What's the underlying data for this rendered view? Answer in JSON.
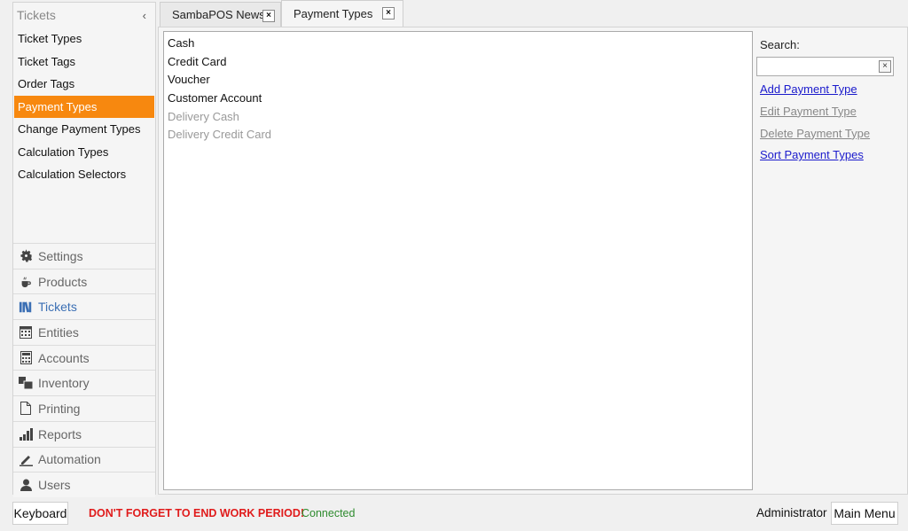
{
  "sidebar": {
    "title": "Tickets",
    "collapse_glyph": "‹",
    "items": [
      {
        "label": "Ticket Types"
      },
      {
        "label": "Ticket Tags"
      },
      {
        "label": "Order Tags"
      },
      {
        "label": "Payment Types",
        "active": true
      },
      {
        "label": "Change Payment Types"
      },
      {
        "label": "Calculation Types"
      },
      {
        "label": "Calculation Selectors"
      }
    ]
  },
  "nav": {
    "items": [
      {
        "label": "Settings",
        "icon": "gear-icon"
      },
      {
        "label": "Products",
        "icon": "cup-icon"
      },
      {
        "label": "Tickets",
        "icon": "books-icon",
        "active": true
      },
      {
        "label": "Entities",
        "icon": "calendar-icon"
      },
      {
        "label": "Accounts",
        "icon": "calculator-icon"
      },
      {
        "label": "Inventory",
        "icon": "boxes-icon"
      },
      {
        "label": "Printing",
        "icon": "document-icon"
      },
      {
        "label": "Reports",
        "icon": "bar-chart-icon"
      },
      {
        "label": "Automation",
        "icon": "pencil-icon"
      },
      {
        "label": "Users",
        "icon": "user-icon"
      }
    ]
  },
  "tabs": [
    {
      "label": "SambaPOS News",
      "close": "×"
    },
    {
      "label": "Payment Types",
      "close": "×",
      "active": true
    }
  ],
  "payment_list": [
    {
      "label": "Cash",
      "enabled": true
    },
    {
      "label": "Credit Card",
      "enabled": true
    },
    {
      "label": "Voucher",
      "enabled": true
    },
    {
      "label": "Customer Account",
      "enabled": true
    },
    {
      "label": "Delivery Cash",
      "enabled": false
    },
    {
      "label": "Delivery Credit Card",
      "enabled": false
    }
  ],
  "search": {
    "label": "Search:",
    "value": "",
    "clear": "×"
  },
  "actions": [
    {
      "label": "Add Payment Type",
      "enabled": true
    },
    {
      "label": "Edit Payment Type",
      "enabled": false
    },
    {
      "label": "Delete Payment Type",
      "enabled": false
    },
    {
      "label": "Sort Payment Types",
      "enabled": true
    }
  ],
  "footer": {
    "keyboard_label": "Keyboard",
    "warning": "DON'T FORGET TO END WORK PERIOD!",
    "status": "Connected",
    "user": "Administrator",
    "main_menu_label": "Main Menu"
  },
  "colors": {
    "accent": "#f7880f",
    "link": "#1a1acc",
    "warning": "#e01b1b",
    "status_ok": "#2e8b2e",
    "nav_active": "#3b6fb4"
  }
}
